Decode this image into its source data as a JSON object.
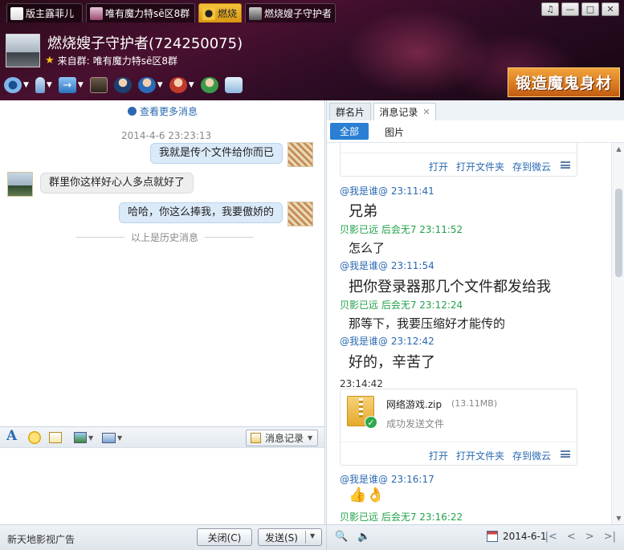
{
  "tabs": [
    {
      "label": "版主露菲儿",
      "active": false
    },
    {
      "label": "唯有魔力特sē区8群",
      "active": false
    },
    {
      "label": "燃烧",
      "active": true
    },
    {
      "label": "燃烧嫂子守护者",
      "active": false
    }
  ],
  "window_controls": {
    "skin": "♫",
    "minimize": "—",
    "maximize": "□",
    "close": "✕"
  },
  "header": {
    "chat_name": "燃烧嫂子守护者(724250075)",
    "group_prefix": "来自群:",
    "group_name": "唯有魔力特sē区8群",
    "ad_banner": "锻造魔鬼身材"
  },
  "toolbar_icons": [
    "video-icon",
    "voice-icon",
    "file-transfer-icon",
    "screen-share-icon",
    "group-app-icon",
    "add-member-icon",
    "remove-member-icon",
    "invite-icon",
    "message-icon"
  ],
  "chat": {
    "more_messages": "查看更多消息",
    "timestamp": "2014-4-6 23:23:13",
    "messages": [
      {
        "side": "right",
        "text": "我就是传个文件给你而已"
      },
      {
        "side": "left",
        "text": "群里你这样好心人多点就好了"
      },
      {
        "side": "right",
        "text": "哈哈，你这么捧我，我要傲娇的"
      }
    ],
    "history_divider": "以上是历史消息"
  },
  "input_toolbar": {
    "message_record_label": "消息记录"
  },
  "bottom": {
    "ad_text": "新天地影视广告",
    "close_label": "关闭(C)",
    "send_label": "发送(S)"
  },
  "right_panel": {
    "tabs": [
      {
        "label": "群名片",
        "active": false
      },
      {
        "label": "消息记录",
        "active": true
      }
    ],
    "filters": {
      "all": "全部",
      "pictures": "图片"
    },
    "file_actions": {
      "open": "打开",
      "open_folder": "打开文件夹",
      "save_cloud": "存到微云"
    },
    "records": [
      {
        "sender": "@我是谁@ 23:11:41",
        "who": "me",
        "text": "兄弟",
        "size": "big"
      },
      {
        "sender": "贝影已远 后会无7 23:11:52",
        "who": "other",
        "text": "怎么了",
        "size": "med"
      },
      {
        "sender": "@我是谁@ 23:11:54",
        "who": "me",
        "text": "把你登录器那几个文件都发给我",
        "size": "big"
      },
      {
        "sender": "贝影已远 后会无7 23:12:24",
        "who": "other",
        "text": "那等下，我要压缩好才能传的",
        "size": "med"
      },
      {
        "sender": "@我是谁@ 23:12:42",
        "who": "me",
        "text": "好的，辛苦了",
        "size": "big"
      }
    ],
    "file_time": "23:14:42",
    "file": {
      "name": "网络游戏.zip",
      "size": "(13.11MB)",
      "status": "成功发送文件"
    },
    "last_sender": "@我是谁@ 23:16:17",
    "last_emoji": "👍👌",
    "last_other": "贝影已远 后会无7 23:16:22",
    "date": "2014-6-1"
  }
}
